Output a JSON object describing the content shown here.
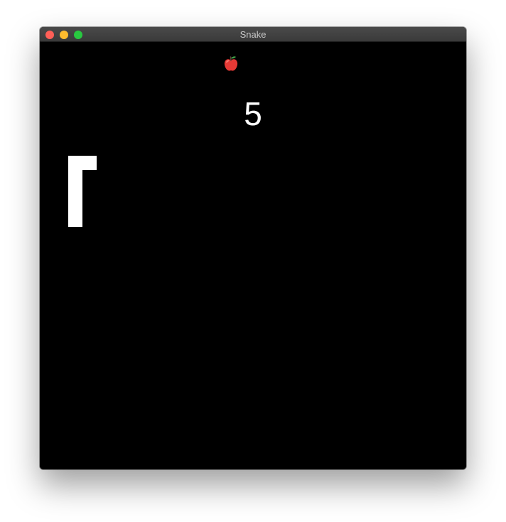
{
  "window": {
    "title": "Snake",
    "buttons": {
      "close_color": "#ff5f57",
      "minimize_color": "#febc2e",
      "maximize_color": "#28c840"
    }
  },
  "game": {
    "background_color": "#000000",
    "score": "5",
    "snake_color": "#ffffff",
    "food_icon": "apple-icon",
    "food_color": "#e53935"
  }
}
